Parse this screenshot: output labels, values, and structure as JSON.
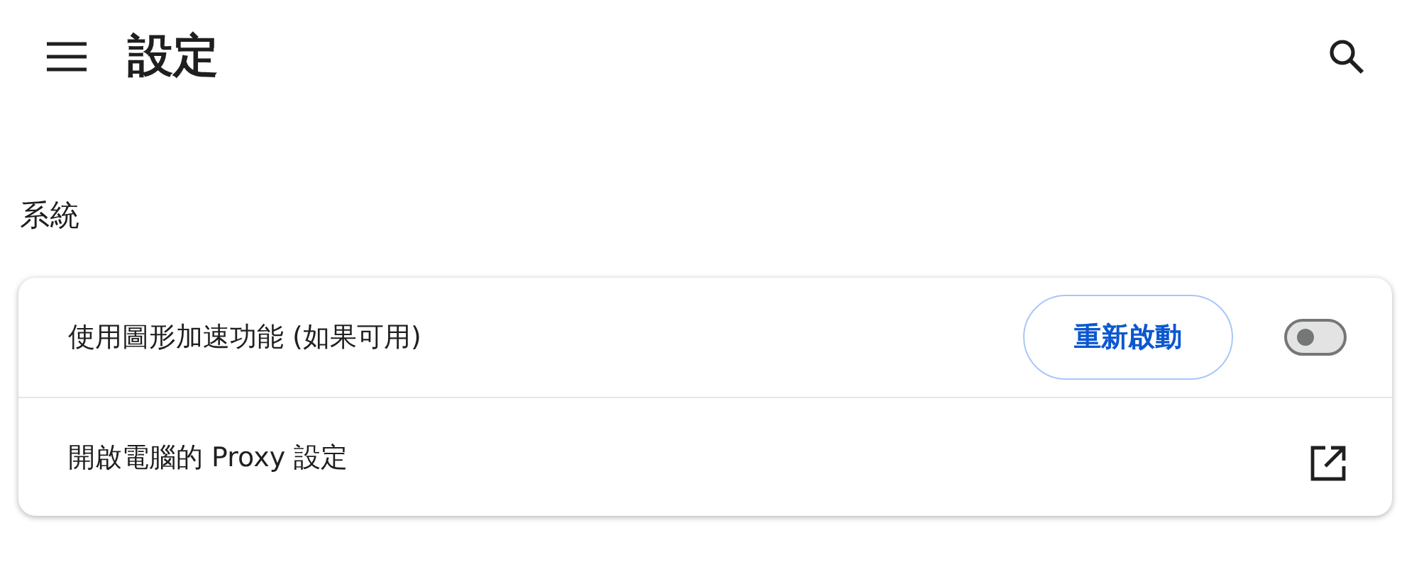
{
  "header": {
    "title": "設定"
  },
  "section": {
    "title": "系統"
  },
  "rows": [
    {
      "kind": "toggle",
      "label": "使用圖形加速功能 (如果可用)",
      "button": "重新啟動",
      "on": false
    },
    {
      "kind": "link",
      "label": "開啟電腦的 Proxy 設定"
    }
  ]
}
